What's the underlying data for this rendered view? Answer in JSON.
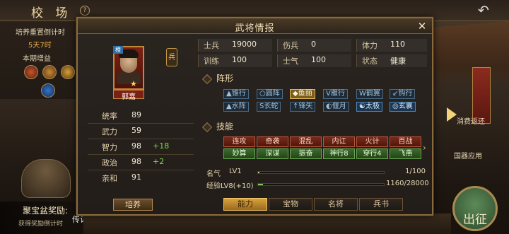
{
  "scene": {
    "title": "校 场",
    "help": "?",
    "back": "↶",
    "left_panel": {
      "reset_label": "培养重置倒计时",
      "countdown": "5天7时",
      "period_label": "本期增益"
    },
    "treasure": {
      "title": "聚宝盆奖励:",
      "sub": "获得奖励倒计时"
    },
    "scroll_label": "传记",
    "right_labels": [
      "消费返还",
      "国器应用"
    ],
    "go_label": "出征"
  },
  "dialog": {
    "title": "武将情报",
    "close": "✕",
    "hero": {
      "name": "郭嘉",
      "rarity": "橙",
      "troop_type": "兵"
    },
    "attributes": [
      {
        "label": "统率",
        "value": "89",
        "bonus": ""
      },
      {
        "label": "武力",
        "value": "59",
        "bonus": ""
      },
      {
        "label": "智力",
        "value": "98",
        "bonus": "+18"
      },
      {
        "label": "政治",
        "value": "98",
        "bonus": "+2"
      },
      {
        "label": "亲和",
        "value": "91",
        "bonus": ""
      }
    ],
    "train_label": "培养",
    "stats": [
      {
        "label": "士兵",
        "value": "19000"
      },
      {
        "label": "伤兵",
        "value": "0"
      },
      {
        "label": "体力",
        "value": "110"
      },
      {
        "label": "训练",
        "value": "100"
      },
      {
        "label": "士气",
        "value": "100"
      },
      {
        "label": "状态",
        "value": "健康"
      }
    ],
    "formation_title": "阵形",
    "formations": [
      {
        "label": "锥行",
        "icon": "▲",
        "state": "normal"
      },
      {
        "label": "圆阵",
        "icon": "○",
        "state": "normal"
      },
      {
        "label": "鱼丽",
        "icon": "◆",
        "state": "active"
      },
      {
        "label": "雁行",
        "icon": "V",
        "state": "normal"
      },
      {
        "label": "鹤翼",
        "icon": "W",
        "state": "normal"
      },
      {
        "label": "钩行",
        "icon": "↙",
        "state": "normal"
      },
      {
        "label": "水阵",
        "icon": "▲",
        "state": "normal"
      },
      {
        "label": "长蛇",
        "icon": "S",
        "state": "normal"
      },
      {
        "label": "锋矢",
        "icon": "↑",
        "state": "normal"
      },
      {
        "label": "偃月",
        "icon": "◐",
        "state": "normal"
      },
      {
        "label": "太极",
        "icon": "☯",
        "state": "blue"
      },
      {
        "label": "玄襄",
        "icon": "◎",
        "state": "blue"
      }
    ],
    "skills_title": "技能",
    "skills_row1": [
      "连攻",
      "奇袭",
      "混乱",
      "内讧",
      "火计",
      "百战"
    ],
    "skills_row2": [
      "妙算",
      "深谋",
      "振奋",
      "神行8",
      "穿行4",
      "飞燕"
    ],
    "fame": {
      "label": "名气",
      "level": "LV1",
      "text": "1/100",
      "fraction": 0.01
    },
    "exp": {
      "label": "经验LV8(+10)",
      "text": "1160/28000",
      "fraction": 0.04
    },
    "tabs": [
      "能力",
      "宝物",
      "名将",
      "兵书"
    ],
    "active_tab": "能力"
  },
  "colors": {
    "frame": "#8a6a3d",
    "bonus": "#7fd648",
    "active_tab": "#d8a23e"
  }
}
